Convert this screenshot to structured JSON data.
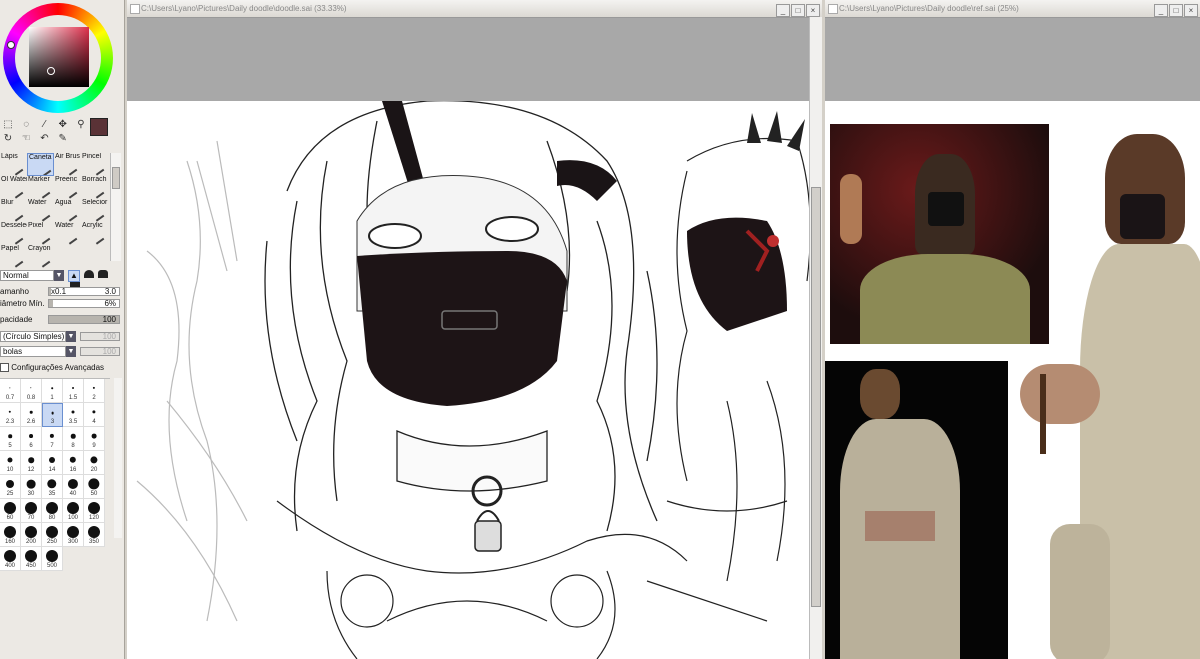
{
  "panel": {
    "tools_row": [
      "⬚",
      "◌",
      "⁄",
      "✥",
      "⚲",
      "↻",
      "☜",
      "↶",
      "✎"
    ],
    "brushes": [
      {
        "label": "Lápis",
        "selected": false
      },
      {
        "label": "Caneta",
        "selected": true
      },
      {
        "label": "Air Brus",
        "selected": false
      },
      {
        "label": "Pincel",
        "selected": false
      },
      {
        "label": "Ol Water",
        "selected": false
      },
      {
        "label": "Marker",
        "selected": false
      },
      {
        "label": "Preenc",
        "selected": false
      },
      {
        "label": "Borrach",
        "selected": false
      },
      {
        "label": "Blur",
        "selected": false
      },
      {
        "label": "Water",
        "selected": false
      },
      {
        "label": "Água",
        "selected": false
      },
      {
        "label": "Selecior",
        "selected": false
      },
      {
        "label": "Desselec",
        "selected": false
      },
      {
        "label": "Pixel",
        "selected": false
      },
      {
        "label": "Water",
        "selected": false
      },
      {
        "label": "Acrylic",
        "selected": false
      },
      {
        "label": "Papel",
        "selected": false
      },
      {
        "label": "Crayon",
        "selected": false
      }
    ],
    "blend_mode": "Normal",
    "size_label": "amanho",
    "size_mult": "x0.1",
    "size_value": "3.0",
    "min_diam_label": "iâmetro Mín.",
    "min_diam_value": "6%",
    "opacity_label": "pacidade",
    "opacity_value": "100",
    "shape_select": "(Círculo Simples)",
    "shape_value": "100",
    "texture_select": "bolas",
    "texture_value": "100",
    "advanced_label": "Configurações Avançadas",
    "brush_sizes": [
      "0.7",
      "0.8",
      "1",
      "1.5",
      "2",
      "2.3",
      "2.6",
      "3",
      "3.5",
      "4",
      "5",
      "6",
      "7",
      "8",
      "9",
      "10",
      "12",
      "14",
      "16",
      "20",
      "25",
      "30",
      "35",
      "40",
      "50",
      "60",
      "70",
      "80",
      "100",
      "120",
      "160",
      "200",
      "250",
      "300",
      "350",
      "400",
      "450",
      "500"
    ],
    "selected_size": "3"
  },
  "windows": [
    {
      "title": "C:\\Users\\Lyano\\Pictures\\Daily doodle\\doodle.sai (33.33%)",
      "controls": [
        "_",
        "□",
        "×"
      ]
    },
    {
      "title": "C:\\Users\\Lyano\\Pictures\\Daily doodle\\ref.sai (25%)",
      "controls": [
        "_",
        "□",
        "×"
      ]
    }
  ]
}
